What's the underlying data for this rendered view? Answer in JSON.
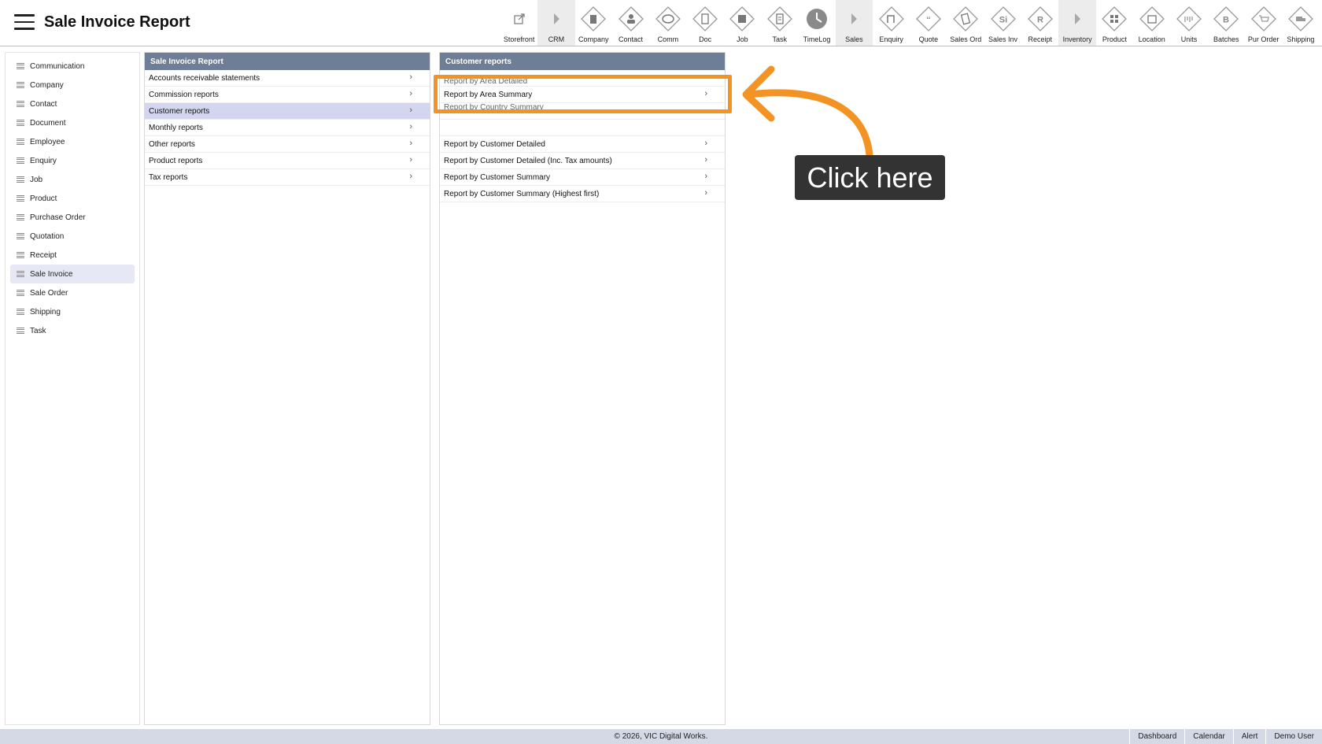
{
  "header": {
    "title": "Sale Invoice Report",
    "menu_icon": "hamburger-menu-icon"
  },
  "toolbar": [
    {
      "label": "Storefront",
      "icon": "external-link-icon",
      "group": false
    },
    {
      "label": "CRM",
      "icon": "caret-right-icon",
      "group": true
    },
    {
      "label": "Company",
      "icon": "company-icon",
      "group": false
    },
    {
      "label": "Contact",
      "icon": "contact-icon",
      "group": false
    },
    {
      "label": "Comm",
      "icon": "comm-icon",
      "group": false
    },
    {
      "label": "Doc",
      "icon": "doc-icon",
      "group": false
    },
    {
      "label": "Job",
      "icon": "job-icon",
      "group": false
    },
    {
      "label": "Task",
      "icon": "task-icon",
      "group": false
    },
    {
      "label": "TimeLog",
      "icon": "clock-icon",
      "group": false
    },
    {
      "label": "Sales",
      "icon": "caret-right-icon",
      "group": true
    },
    {
      "label": "Enquiry",
      "icon": "enquiry-icon",
      "group": false
    },
    {
      "label": "Quote",
      "icon": "quote-icon",
      "group": false
    },
    {
      "label": "Sales Ord",
      "icon": "sales-order-icon",
      "group": false
    },
    {
      "label": "Sales Inv",
      "icon": "sales-invoice-icon",
      "group": false
    },
    {
      "label": "Receipt",
      "icon": "receipt-icon",
      "group": false
    },
    {
      "label": "Inventory",
      "icon": "caret-right-icon",
      "group": true
    },
    {
      "label": "Product",
      "icon": "product-icon",
      "group": false
    },
    {
      "label": "Location",
      "icon": "location-icon",
      "group": false
    },
    {
      "label": "Units",
      "icon": "units-icon",
      "group": false
    },
    {
      "label": "Batches",
      "icon": "batches-icon",
      "group": false
    },
    {
      "label": "Pur Order",
      "icon": "cart-icon",
      "group": false
    },
    {
      "label": "Shipping",
      "icon": "truck-icon",
      "group": false
    }
  ],
  "toolbar_glyphs": {
    "Receipt": "R",
    "Sales Inv": "Si",
    "Batches": "B"
  },
  "sidebar": {
    "items": [
      {
        "label": "Communication",
        "active": false
      },
      {
        "label": "Company",
        "active": false
      },
      {
        "label": "Contact",
        "active": false
      },
      {
        "label": "Document",
        "active": false
      },
      {
        "label": "Employee",
        "active": false
      },
      {
        "label": "Enquiry",
        "active": false
      },
      {
        "label": "Job",
        "active": false
      },
      {
        "label": "Product",
        "active": false
      },
      {
        "label": "Purchase Order",
        "active": false
      },
      {
        "label": "Quotation",
        "active": false
      },
      {
        "label": "Receipt",
        "active": false
      },
      {
        "label": "Sale Invoice",
        "active": true
      },
      {
        "label": "Sale Order",
        "active": false
      },
      {
        "label": "Shipping",
        "active": false
      },
      {
        "label": "Task",
        "active": false
      }
    ]
  },
  "panel1": {
    "title": "Sale Invoice Report",
    "items": [
      {
        "label": "Accounts receivable statements",
        "active": false
      },
      {
        "label": "Commission reports",
        "active": false
      },
      {
        "label": "Customer reports",
        "active": true
      },
      {
        "label": "Monthly reports",
        "active": false
      },
      {
        "label": "Other reports",
        "active": false
      },
      {
        "label": "Product reports",
        "active": false
      },
      {
        "label": "Tax reports",
        "active": false
      }
    ]
  },
  "panel2": {
    "title": "Customer reports",
    "items": [
      {
        "label": "Report by Area Detailed",
        "partial": "top"
      },
      {
        "label": "Report by Area Summary",
        "partial": ""
      },
      {
        "label": "Report by Country Summary",
        "partial": "bottom"
      },
      {
        "label": "",
        "partial": "blank"
      },
      {
        "label": "Report by Customer Detailed",
        "partial": ""
      },
      {
        "label": "Report by Customer Detailed (Inc. Tax amounts)",
        "partial": ""
      },
      {
        "label": "Report by Customer Summary",
        "partial": ""
      },
      {
        "label": "Report by Customer Summary (Highest first)",
        "partial": ""
      }
    ]
  },
  "annotation": {
    "callout_text": "Click here",
    "color": "#f39323"
  },
  "footer": {
    "copyright": "© 2026, VIC Digital Works.",
    "links": [
      "Dashboard",
      "Calendar",
      "Alert",
      "Demo User"
    ]
  },
  "colors": {
    "panel_header": "#6e7e96",
    "active_row": "#d3d6ee",
    "footer_bg": "#d5d9e6"
  }
}
